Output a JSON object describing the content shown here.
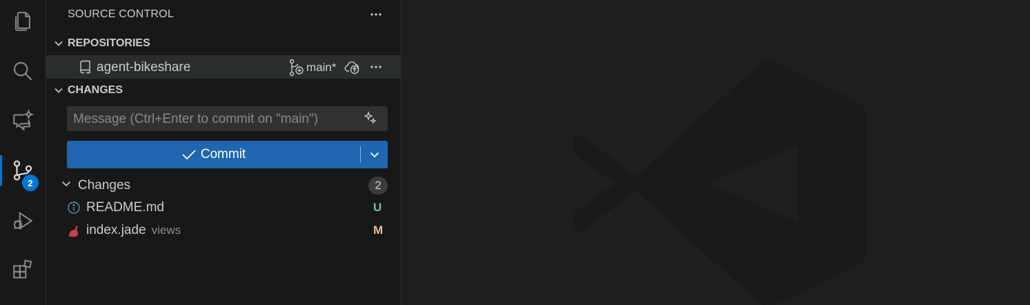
{
  "colors": {
    "accent": "#0078d4",
    "commit_button": "#1f65b0",
    "untracked": "#73c991",
    "modified": "#e2c08d"
  },
  "activity_bar": {
    "items": [
      {
        "name": "explorer",
        "icon": "files-icon"
      },
      {
        "name": "search",
        "icon": "search-icon"
      },
      {
        "name": "chat",
        "icon": "chat-sparkle-icon"
      },
      {
        "name": "source-control",
        "icon": "source-control-icon",
        "badge": "2",
        "active": true
      },
      {
        "name": "run-and-debug",
        "icon": "run-debug-icon"
      },
      {
        "name": "extensions",
        "icon": "extensions-icon"
      }
    ]
  },
  "sidebar": {
    "title": "SOURCE CONTROL",
    "repositories": {
      "header": "REPOSITORIES",
      "repo_name": "agent-bikeshare",
      "branch": "main*"
    },
    "changes": {
      "header": "CHANGES",
      "message_placeholder": "Message (Ctrl+Enter to commit on \"main\")",
      "commit_label": "Commit",
      "group_label": "Changes",
      "group_count": "2",
      "files": [
        {
          "name": "README.md",
          "dir": "",
          "status": "U",
          "icon": "info-icon"
        },
        {
          "name": "index.jade",
          "dir": "views",
          "status": "M",
          "icon": "jade-file-icon"
        }
      ]
    }
  },
  "editor": {
    "watermark": "vscode-logo-watermark"
  }
}
